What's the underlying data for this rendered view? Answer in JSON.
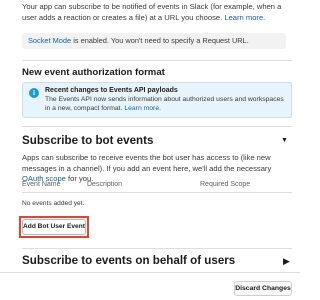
{
  "intro": {
    "text": "Your app can subscribe to be notified of events in Slack (for example, when a user adds a reaction or creates a file) at a URL you choose.",
    "learn_more": "Learn more."
  },
  "socket": {
    "link": "Socket Mode",
    "text": " is enabled. You won't need to specify a Request URL."
  },
  "new_format": {
    "title": "New event authorization format",
    "info_title": "Recent changes to Events API payloads",
    "info_body": "The Events API now sends information about authorized users and workspaces in a new, compact format.",
    "info_learn_more": "Learn more."
  },
  "bot_events": {
    "title": "Subscribe to bot events",
    "description": "Apps can subscribe to receive events the bot user has access to (like new messages in a channel). If you add an event here, we'll add the necessary ",
    "oauth_link": "OAuth scope",
    "description_end": " for you.",
    "columns": [
      "Event Name",
      "Description",
      "Required Scope"
    ],
    "empty": "No events added yet.",
    "add_button": "Add Bot User Event"
  },
  "user_events": {
    "title": "Subscribe to events on behalf of users"
  },
  "footer": {
    "discard_button": "Discard Changes"
  }
}
